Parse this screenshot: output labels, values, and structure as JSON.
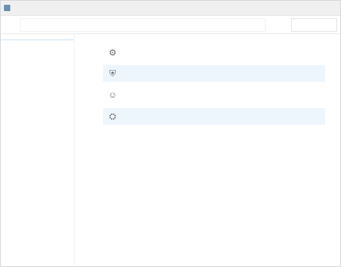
{
  "window": {
    "title": "",
    "controls": [
      "",
      "",
      ""
    ]
  },
  "addressbar": {
    "back_label": "",
    "path": "",
    "refresh_label": "",
    "search_placeholder": ""
  },
  "sidebar": {
    "items": [
      {
        "label": "",
        "selected": true
      },
      {
        "label": ""
      },
      {
        "label": ""
      },
      {
        "label": ""
      },
      {
        "label": ""
      },
      {
        "label": ""
      },
      {
        "label": ""
      },
      {
        "label": ""
      },
      {
        "label": ""
      }
    ]
  },
  "main": {
    "entries": [
      {
        "icon": "gear-icon",
        "title": "",
        "description": [
          "",
          ""
        ]
      },
      {
        "icon": "shield-icon",
        "title": "",
        "description": [
          ""
        ]
      },
      {
        "icon": "user-icon",
        "title": "",
        "description": [
          ""
        ]
      },
      {
        "icon": "settings-icon",
        "title": "",
        "description": [
          "",
          ""
        ]
      }
    ]
  },
  "colors": {
    "accent": "#1a6fb8",
    "selection": "#e5f1fb",
    "hover": "#eef6fd"
  }
}
